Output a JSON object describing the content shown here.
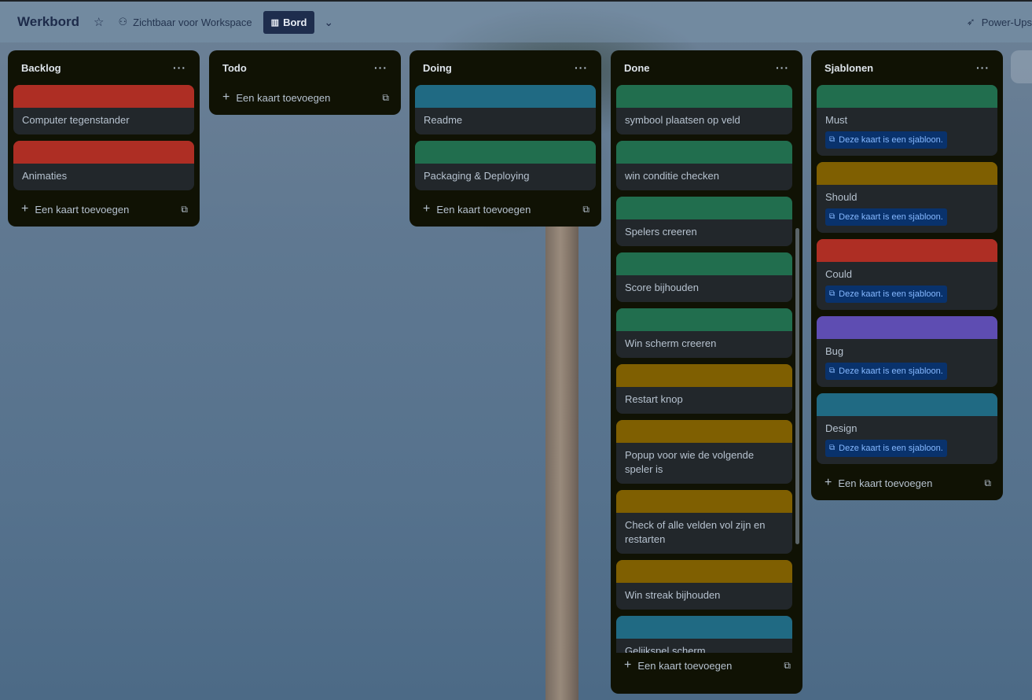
{
  "header": {
    "board_title": "Werkbord",
    "star_icon": "star-icon",
    "visibility_label": "Zichtbaar voor Workspace",
    "view_label": "Bord",
    "powerups_label": "Power-Ups"
  },
  "colors": {
    "red": "#ae2e24",
    "green": "#216e4e",
    "teal": "#206a83",
    "yellow": "#7f5f01",
    "purple": "#5e4db2"
  },
  "lists": {
    "backlog": {
      "title": "Backlog",
      "cards": [
        {
          "title": "Computer tegenstander",
          "cover": "red"
        },
        {
          "title": "Animaties",
          "cover": "red"
        }
      ],
      "add_card_label": "Een kaart toevoegen"
    },
    "todo": {
      "title": "Todo",
      "add_card_label": "Een kaart toevoegen"
    },
    "doing": {
      "title": "Doing",
      "cards": [
        {
          "title": "Readme",
          "cover": "teal"
        },
        {
          "title": "Packaging & Deploying",
          "cover": "green"
        }
      ],
      "add_card_label": "Een kaart toevoegen"
    },
    "done": {
      "title": "Done",
      "cards": [
        {
          "title": "symbool plaatsen op veld",
          "cover": "green"
        },
        {
          "title": "win conditie checken",
          "cover": "green"
        },
        {
          "title": "Spelers creeren",
          "cover": "green"
        },
        {
          "title": "Score bijhouden",
          "cover": "green"
        },
        {
          "title": "Win scherm creeren",
          "cover": "green"
        },
        {
          "title": "Restart knop",
          "cover": "yellow"
        },
        {
          "title": "Popup voor wie de volgende speler is",
          "cover": "yellow"
        },
        {
          "title": "Check of alle velden vol zijn en restarten",
          "cover": "yellow"
        },
        {
          "title": "Win streak bijhouden",
          "cover": "yellow"
        },
        {
          "title": "Gelijkspel scherm",
          "cover": "teal"
        }
      ],
      "add_card_label": "Een kaart toevoegen"
    },
    "sjablonen": {
      "title": "Sjablonen",
      "template_badge": "Deze kaart is een sjabloon.",
      "cards": [
        {
          "title": "Must",
          "cover": "green"
        },
        {
          "title": "Should",
          "cover": "yellow"
        },
        {
          "title": "Could",
          "cover": "red"
        },
        {
          "title": "Bug",
          "cover": "purple"
        },
        {
          "title": "Design",
          "cover": "teal"
        }
      ],
      "add_card_label": "Een kaart toevoegen"
    }
  }
}
